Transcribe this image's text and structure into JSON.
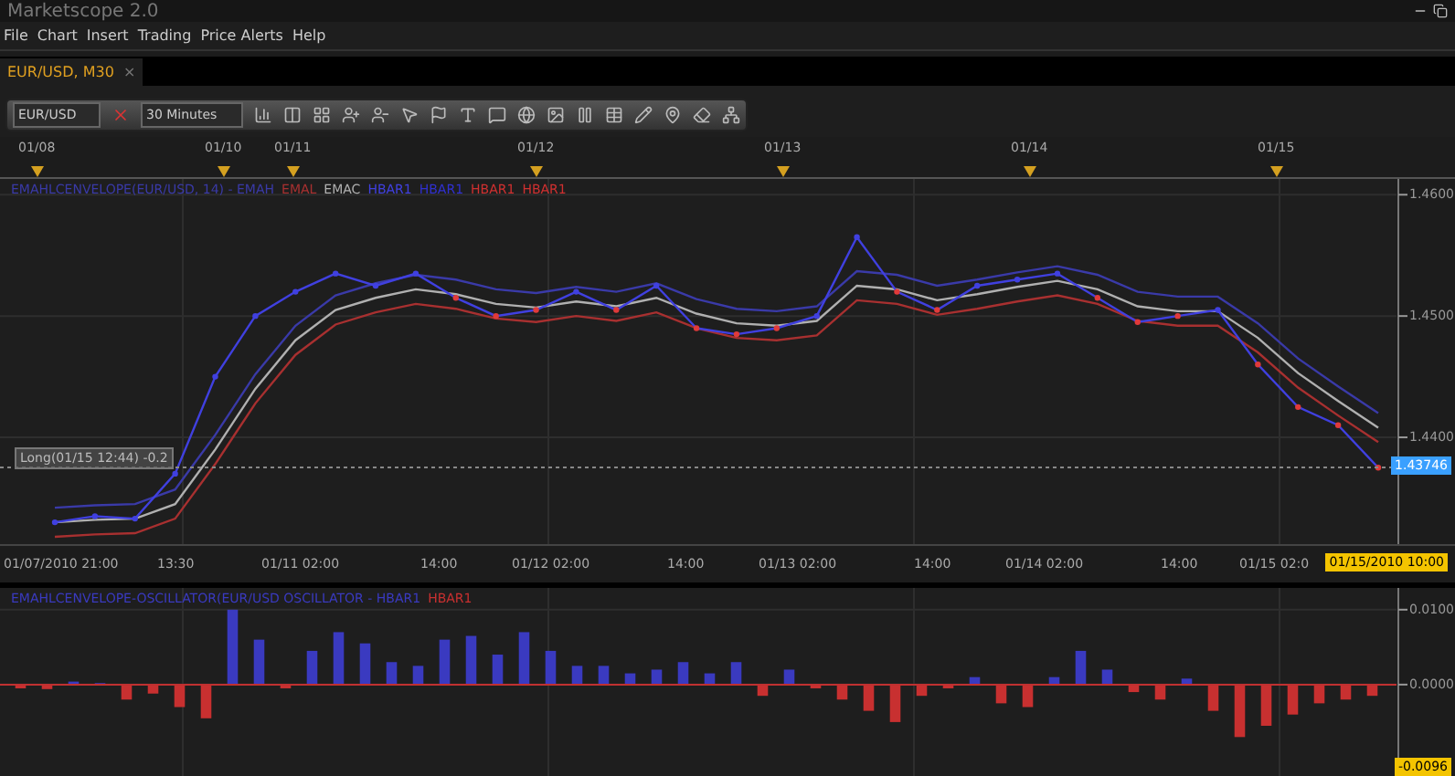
{
  "window": {
    "title": "Marketscope 2.0"
  },
  "menu": [
    "File",
    "Chart",
    "Insert",
    "Trading",
    "Price Alerts",
    "Help"
  ],
  "tabs": [
    {
      "label": "EUR/USD, M30",
      "selected": true,
      "close": "×"
    }
  ],
  "toolbar": {
    "instrument": "EUR/USD",
    "timeframe": "30 Minutes"
  },
  "date_markers": [
    "01/08",
    "01/10",
    "01/11",
    "01/12",
    "01/13",
    "01/14",
    "01/15"
  ],
  "price_panel": {
    "extra_legend": [
      {
        "text": "HBAR1",
        "color": "#3030d0"
      },
      {
        "text": "HBAR1",
        "color": "#d03030"
      },
      {
        "text": "HBAR1",
        "color": "#d03030"
      }
    ],
    "order_label": "Long(01/15 12:44) -0.2",
    "current_price": "1.43746",
    "chart_data": {
      "type": "line",
      "grid": true,
      "ylim": [
        1.4312,
        1.4613
      ],
      "yticks": [
        {
          "value": 1.44,
          "label": "1.4400"
        },
        {
          "value": 1.45,
          "label": "1.4500"
        },
        {
          "value": 1.46,
          "label": "1.4600"
        }
      ],
      "series": [
        {
          "name": "EMAHLCENVELOPE(EUR/USD, 14) - EMAH",
          "color": "#3a3aa8",
          "values": [
            1.4342,
            1.4344,
            1.4345,
            1.4357,
            1.4402,
            1.4452,
            1.4492,
            1.4517,
            1.4527,
            1.4534,
            1.453,
            1.4522,
            1.4519,
            1.4524,
            1.452,
            1.4527,
            1.4514,
            1.4506,
            1.4504,
            1.4508,
            1.4537,
            1.4534,
            1.4525,
            1.453,
            1.4536,
            1.4541,
            1.4534,
            1.452,
            1.4516,
            1.4516,
            1.4494,
            1.4465,
            1.4442,
            1.442
          ]
        },
        {
          "name": "EMAL",
          "color": "#a83030",
          "values": [
            1.4318,
            1.432,
            1.4321,
            1.4333,
            1.4378,
            1.4428,
            1.4468,
            1.4493,
            1.4503,
            1.451,
            1.4506,
            1.4498,
            1.4495,
            1.45,
            1.4496,
            1.4503,
            1.449,
            1.4482,
            1.448,
            1.4484,
            1.4513,
            1.451,
            1.4501,
            1.4506,
            1.4512,
            1.4517,
            1.451,
            1.4496,
            1.4492,
            1.4492,
            1.447,
            1.4441,
            1.4418,
            1.4396
          ]
        },
        {
          "name": "EMAC",
          "color": "#b0b0b0",
          "values": [
            1.433,
            1.4332,
            1.4333,
            1.4345,
            1.439,
            1.444,
            1.448,
            1.4505,
            1.4515,
            1.4522,
            1.4518,
            1.451,
            1.4507,
            1.4512,
            1.4508,
            1.4515,
            1.4502,
            1.4494,
            1.4492,
            1.4496,
            1.4525,
            1.4522,
            1.4513,
            1.4518,
            1.4524,
            1.4529,
            1.4522,
            1.4508,
            1.4504,
            1.4504,
            1.4482,
            1.4453,
            1.443,
            1.4408
          ]
        },
        {
          "name": "HBAR1",
          "color": "#4040e0",
          "marker": "circle",
          "values": [
            1.433,
            1.4335,
            1.4333,
            1.437,
            1.445,
            1.45,
            1.452,
            1.4535,
            1.4525,
            1.4535,
            1.4515,
            1.45,
            1.4505,
            1.452,
            1.4505,
            1.4525,
            1.449,
            1.4485,
            1.449,
            1.45,
            1.4565,
            1.452,
            1.4505,
            1.4525,
            1.453,
            1.4535,
            1.4515,
            1.4495,
            1.45,
            1.4505,
            1.446,
            1.4425,
            1.441,
            1.4375
          ]
        }
      ]
    }
  },
  "time_axis": [
    "01/07/2010 21:00",
    "13:30",
    "01/11 02:00",
    "14:00",
    "01/12 02:00",
    "14:00",
    "01/13 02:00",
    "14:00",
    "01/14 02:00",
    "14:00",
    "01/15 02:0"
  ],
  "cursor_time": "01/15/2010 10:00",
  "oscillator_panel": {
    "cursor_value": "-0.0096",
    "chart_data": {
      "type": "bar",
      "grid": true,
      "ylim": [
        -0.0122,
        0.0129
      ],
      "yticks": [
        {
          "value": 0,
          "label": "0.0000"
        },
        {
          "value": 0.01,
          "label": "0.0100"
        }
      ],
      "series": [
        {
          "name": "EMAHLCENVELOPE-OSCILLATOR(EUR/USD OSCILLATOR - HBAR1",
          "color": "#3a3ac0",
          "values": [
            null,
            null,
            0.0004,
            0.0002,
            null,
            null,
            null,
            null,
            0.01,
            0.006,
            null,
            0.0045,
            0.007,
            0.0055,
            0.003,
            0.0025,
            0.006,
            0.0065,
            0.004,
            0.007,
            0.0045,
            0.0025,
            0.0025,
            0.0015,
            0.002,
            0.003,
            0.0015,
            0.003,
            null,
            0.002,
            null,
            null,
            null,
            null,
            null,
            null,
            0.001,
            null,
            null,
            0.001,
            0.0045,
            0.002,
            null,
            null,
            0.0008,
            null,
            null,
            null,
            null,
            null,
            null,
            null
          ]
        },
        {
          "name": "HBAR1",
          "color": "#c83030",
          "values": [
            -0.0005,
            -0.0006,
            null,
            null,
            -0.002,
            -0.0012,
            -0.003,
            -0.0045,
            null,
            null,
            -0.0005,
            null,
            null,
            null,
            null,
            null,
            null,
            null,
            null,
            null,
            null,
            null,
            null,
            null,
            null,
            null,
            null,
            null,
            -0.0015,
            null,
            -0.0005,
            -0.002,
            -0.0035,
            -0.005,
            -0.0015,
            -0.0005,
            null,
            -0.0025,
            -0.003,
            null,
            null,
            null,
            -0.001,
            -0.002,
            null,
            -0.0035,
            -0.007,
            -0.0055,
            -0.004,
            -0.0025,
            -0.002,
            -0.0015
          ]
        }
      ]
    }
  }
}
